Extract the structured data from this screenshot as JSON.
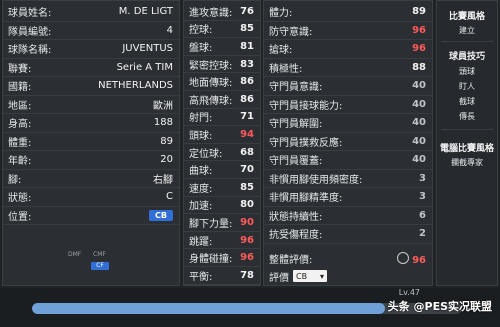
{
  "left": {
    "rows": [
      {
        "label": "球員姓名:",
        "value": "M. DE LIGT"
      },
      {
        "label": "隊員編號:",
        "value": "4"
      },
      {
        "label": "球隊名稱:",
        "value": "JUVENTUS"
      },
      {
        "label": "聯賽:",
        "value": "Serie A TIM"
      },
      {
        "label": "國籍:",
        "value": "NETHERLANDS"
      },
      {
        "label": "地區:",
        "value": "歐洲"
      },
      {
        "label": "身高:",
        "value": "188"
      },
      {
        "label": "體重:",
        "value": "89"
      },
      {
        "label": "年齡:",
        "value": "20"
      },
      {
        "label": "腳:",
        "value": "右腳"
      },
      {
        "label": "狀態:",
        "value": "C"
      },
      {
        "label": "位置:",
        "value": "CB"
      }
    ],
    "minimap": {
      "dmf": "DMF",
      "cmf": "CMF",
      "cf": "CF"
    }
  },
  "mid": {
    "rows": [
      {
        "label": "進攻意識:",
        "value": "76"
      },
      {
        "label": "控球:",
        "value": "85"
      },
      {
        "label": "盤球:",
        "value": "81"
      },
      {
        "label": "緊密控球:",
        "value": "83"
      },
      {
        "label": "地面傳球:",
        "value": "86"
      },
      {
        "label": "高飛傳球:",
        "value": "86"
      },
      {
        "label": "射門:",
        "value": "71"
      },
      {
        "label": "頭球:",
        "value": "94"
      },
      {
        "label": "定位球:",
        "value": "68"
      },
      {
        "label": "曲球:",
        "value": "70"
      },
      {
        "label": "速度:",
        "value": "85"
      },
      {
        "label": "加速:",
        "value": "80"
      },
      {
        "label": "腳下力量:",
        "value": "90"
      },
      {
        "label": "跳躍:",
        "value": "96"
      },
      {
        "label": "身體碰撞:",
        "value": "96"
      },
      {
        "label": "平衡:",
        "value": "78"
      }
    ]
  },
  "right": {
    "rows": [
      {
        "label": "體力:",
        "value": "89"
      },
      {
        "label": "防守意識:",
        "value": "96"
      },
      {
        "label": "搶球:",
        "value": "96"
      },
      {
        "label": "積極性:",
        "value": "88"
      },
      {
        "label": "守門員意識:",
        "value": "40"
      },
      {
        "label": "守門員接球能力:",
        "value": "40"
      },
      {
        "label": "守門員解圍:",
        "value": "40"
      },
      {
        "label": "守門員撲救反應:",
        "value": "40"
      },
      {
        "label": "守門員覆蓋:",
        "value": "40"
      },
      {
        "label": "非慣用腳使用頻密度:",
        "value": "3"
      },
      {
        "label": "非慣用腳精準度:",
        "value": "3"
      },
      {
        "label": "狀態持續性:",
        "value": "6"
      },
      {
        "label": "抗受傷程度:",
        "value": "2"
      }
    ],
    "overall_label": "整體評價:",
    "overall_value": "96",
    "rating_label": "評價",
    "rating_select": "CB"
  },
  "side": {
    "style_title": "比賽風格",
    "style_value": "建立",
    "skills_title": "球員技巧",
    "skills": [
      "頭球",
      "盯人",
      "截球",
      "傳長"
    ],
    "ai_title": "電腦比賽風格",
    "ai_value": "攔截專家"
  },
  "footer": {
    "level": "Lv.47",
    "progress": 0.82,
    "watermark": "头条 @PES实况联盟"
  }
}
